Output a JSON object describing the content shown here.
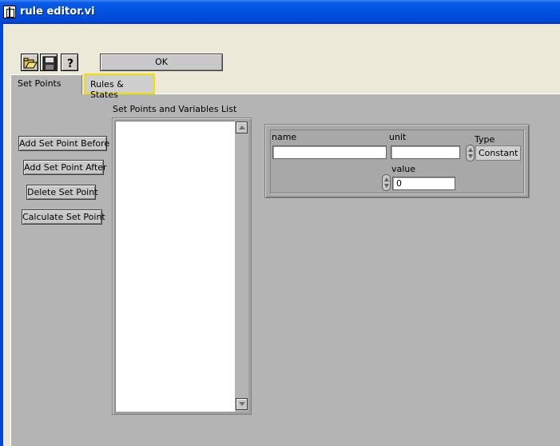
{
  "window": {
    "title": "rule editor.vi"
  },
  "toolbar": {
    "ok_label": "OK"
  },
  "tabs": [
    {
      "label": "Set Points",
      "active": true
    },
    {
      "label": "Rules & States",
      "active": false
    }
  ],
  "set_points": {
    "buttons": {
      "add_before": "Add Set Point Before",
      "add_after": "Add Set Point After",
      "delete": "Delete Set Point",
      "calculate": "Calculate Set Point"
    },
    "list_label": "Set Points and Variables List",
    "list_items": []
  },
  "editor": {
    "name_label": "name",
    "name_value": "",
    "unit_label": "unit",
    "unit_value": "",
    "type_label": "Type",
    "type_value": "Constant",
    "value_label": "value",
    "value_value": "0"
  },
  "colors": {
    "titlebar": "#0151e0",
    "panel": "#b4b4b4",
    "tab_highlight": "#f0e000"
  }
}
